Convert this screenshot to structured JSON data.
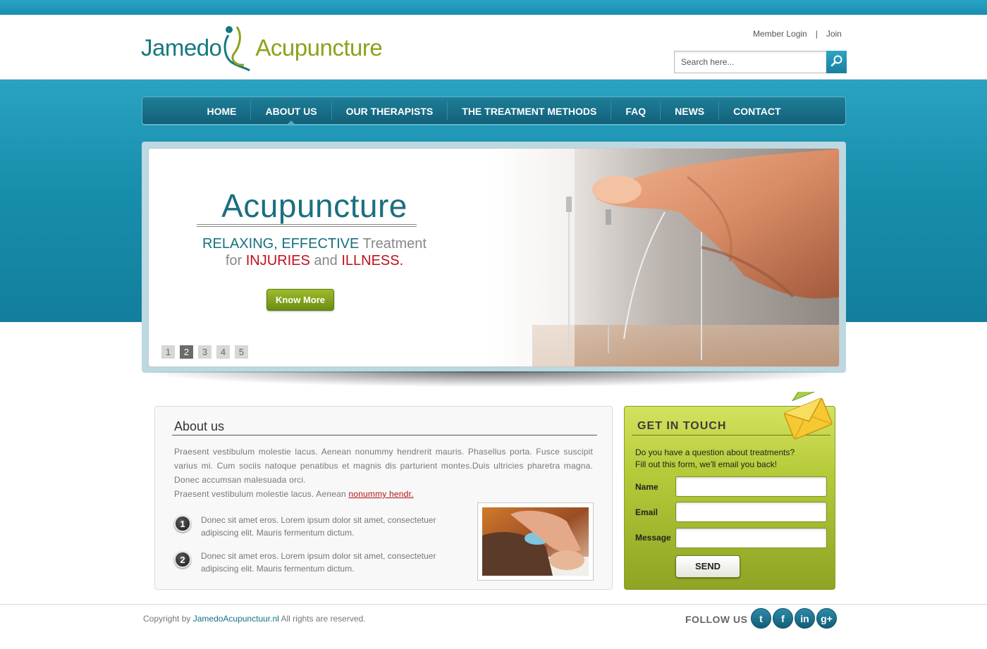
{
  "header": {
    "logo_left": "Jamedo",
    "logo_right": "Acupuncture",
    "member_login": "Member Login",
    "divider": "|",
    "join": "Join",
    "search_placeholder": "Search here..."
  },
  "nav": {
    "items": [
      {
        "label": "HOME"
      },
      {
        "label": "ABOUT US",
        "active": true
      },
      {
        "label": "OUR THERAPISTS"
      },
      {
        "label": "THE TREATMENT METHODS"
      },
      {
        "label": "FAQ"
      },
      {
        "label": "NEWS"
      },
      {
        "label": "CONTACT"
      }
    ]
  },
  "slider": {
    "title": "Acupuncture",
    "line1": {
      "w1": "RELAXING",
      "w2": ",",
      "w3": "EFFECTIVE",
      "w4": "Treatment"
    },
    "line2": {
      "w1": "for",
      "w2": "INJURIES",
      "w3": "and",
      "w4": "ILLNESS."
    },
    "button": "Know More",
    "pages": [
      "1",
      "2",
      "3",
      "4",
      "5"
    ],
    "current_page": "2"
  },
  "about": {
    "heading": "About us",
    "paragraph": "Praesent vestibulum molestie lacus. Aenean nonummy hendrerit mauris. Phasellus porta. Fusce suscipit varius mi. Cum sociis natoque penatibus et magnis dis parturient montes.Duis ultricies pharetra magna. Donec accumsan malesuada orci.",
    "paragraph2": "Praesent vestibulum molestie lacus. Aenean",
    "link": "nonummy hendr.",
    "bullets": [
      {
        "num": "1",
        "text": "Donec sit amet eros. Lorem ipsum dolor sit amet, consectetuer adipiscing elit. Mauris fermentum dictum."
      },
      {
        "num": "2",
        "text": "Donec sit amet eros. Lorem ipsum dolor sit amet, consectetuer adipiscing elit. Mauris fermentum dictum."
      }
    ]
  },
  "contact": {
    "heading": "GET IN TOUCH",
    "intro1": "Do you have a question about treatments?",
    "intro2": "Fill out this form, we'll email you back!",
    "name_label": "Name",
    "email_label": "Email",
    "message_label": "Message",
    "send": "SEND"
  },
  "footer": {
    "copy_prefix": "Copyright by",
    "copy_link": "JamedoAcupunctuur.nl",
    "copy_suffix": "All rights are reserved.",
    "follow": "FOLLOW US",
    "socials": [
      {
        "icon": "twitter-icon",
        "glyph": "t"
      },
      {
        "icon": "facebook-icon",
        "glyph": "f"
      },
      {
        "icon": "linkedin-icon",
        "glyph": "in"
      },
      {
        "icon": "googleplus-icon",
        "glyph": "g+"
      }
    ]
  },
  "colors": {
    "brand_teal": "#16707f",
    "brand_green": "#8aa31d",
    "accent_red": "#c0101b",
    "header_blue": "#1890ae"
  }
}
